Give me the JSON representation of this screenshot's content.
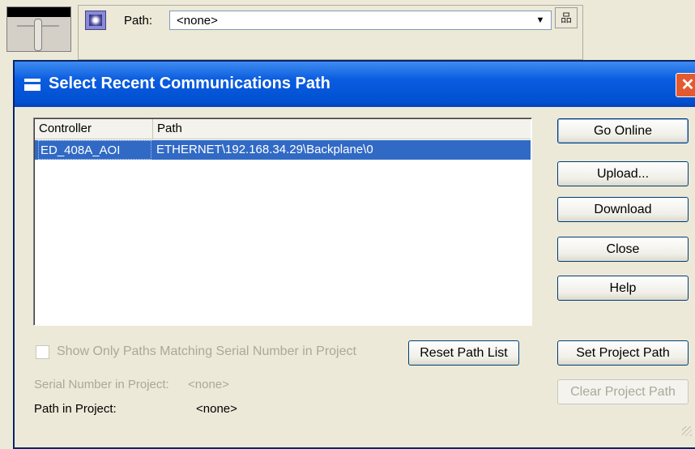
{
  "toolbar": {
    "path_label": "Path:",
    "path_value": "<none>",
    "dropdown_icon": "chevron-down-icon",
    "network_icon": "network-tree-icon"
  },
  "dialog": {
    "title": "Select Recent Communications Path",
    "close_label": "✕",
    "list": {
      "columns": [
        "Controller",
        "Path"
      ],
      "rows": [
        {
          "controller": "ED_408A_AOI",
          "path": "ETHERNET\\192.168.34.29\\Backplane\\0",
          "selected": true
        }
      ]
    },
    "buttons": {
      "go_online": "Go Online",
      "upload": "Upload...",
      "download": "Download",
      "close": "Close",
      "help": "Help",
      "reset_path_list": "Reset Path List",
      "set_project_path": "Set Project Path",
      "clear_project_path": "Clear Project Path"
    },
    "show_only_matching": {
      "label": "Show Only Paths Matching Serial Number in Project",
      "checked": false,
      "enabled": false
    },
    "serial_number": {
      "label": "Serial Number in Project:",
      "value": "<none>"
    },
    "path_in_project": {
      "label": "Path in Project:",
      "value": "<none>"
    }
  },
  "colors": {
    "title_bar": "#0a5ce0",
    "selection": "#316ac5",
    "disabled_text": "#aca899",
    "dialog_face": "#ece9d8"
  }
}
